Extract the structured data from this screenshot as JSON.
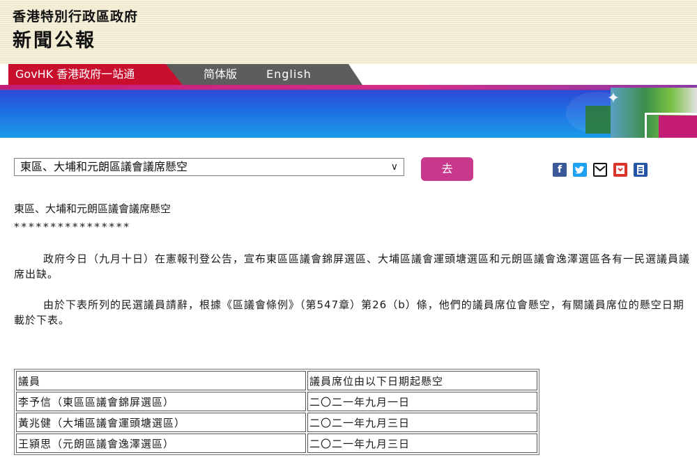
{
  "header": {
    "gov_name": "香港特別行政區政府",
    "press_title": "新聞公報"
  },
  "nav": {
    "govhk_label": "GovHK 香港政府一站通",
    "simplified_label": "简体版",
    "english_label": "English"
  },
  "toolbar": {
    "select_value": "東區、大埔和元朗區議會議席懸空",
    "go_label": "去",
    "share_icons": [
      "facebook-icon",
      "twitter-icon",
      "email-icon",
      "bookmark-icon",
      "print-icon"
    ]
  },
  "article": {
    "title": "東區、大埔和元朗區議會議席懸空",
    "stars": "****************",
    "para1": "政府今日（九月十日）在憲報刊登公告，宣布東區區議會錦屏選區、大埔區議會運頭塘選區和元朗區議會逸澤選區各有一民選議員議席出缺。",
    "para2": "由於下表所列的民選議員請辭，根據《區議會條例》（第547章）第26（b）條，他們的議員席位會懸空，有關議員席位的懸空日期載於下表。"
  },
  "table": {
    "headers": [
      "議員",
      "議員席位由以下日期起懸空"
    ],
    "rows": [
      [
        "李予信（東區區議會錦屏選區）",
        "二〇二一年九月一日"
      ],
      [
        "黃兆健（大埔區議會運頭塘選區）",
        "二〇二一年九月三日"
      ],
      [
        "王潁思（元朗區議會逸澤選區）",
        "二〇二一年九月三日"
      ]
    ]
  },
  "colors": {
    "govhk_red": "#c8102e",
    "tab_gray": "#5d5d5d",
    "go_button": "#c8398e",
    "banner_blue": "#1f6fe3"
  }
}
